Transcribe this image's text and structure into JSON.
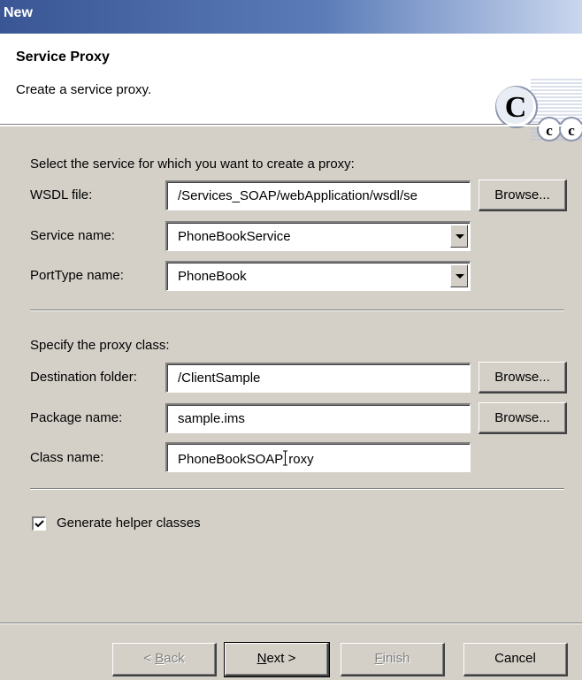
{
  "window": {
    "title": "New"
  },
  "banner": {
    "heading": "Service Proxy",
    "description": "Create a service proxy."
  },
  "service_section": {
    "intro": "Select the service for which you want to create a proxy:",
    "wsdl_label": "WSDL file:",
    "wsdl_value": "/Services_SOAP/webApplication/wsdl/se",
    "service_label": "Service name:",
    "service_value": "PhoneBookService",
    "porttype_label": "PortType name:",
    "porttype_value": "PhoneBook",
    "browse_label": "Browse..."
  },
  "proxy_section": {
    "intro": "Specify the proxy class:",
    "dest_label": "Destination folder:",
    "dest_value": "/ClientSample",
    "package_label": "Package name:",
    "package_value": "sample.ims",
    "class_label": "Class name:",
    "class_value_before": "PhoneBookSOAP",
    "class_value_after": "roxy",
    "browse_label": "Browse..."
  },
  "options": {
    "helper_label": "Generate helper classes",
    "helper_checked": true
  },
  "footer": {
    "back_prefix": "< ",
    "back_key": "B",
    "back_rest": "ack",
    "next_key": "N",
    "next_rest": "ext >",
    "finish_key": "F",
    "finish_rest": "inish",
    "cancel_label": "Cancel"
  },
  "colors": {
    "dialog_bg": "#d4d0c8",
    "title_blue": "#3a5694",
    "logo_letter": "#000000"
  },
  "icons": {
    "logo": "ccc-logo-icon",
    "check": "checkmark-icon",
    "dropdown": "chevron-down-icon"
  }
}
